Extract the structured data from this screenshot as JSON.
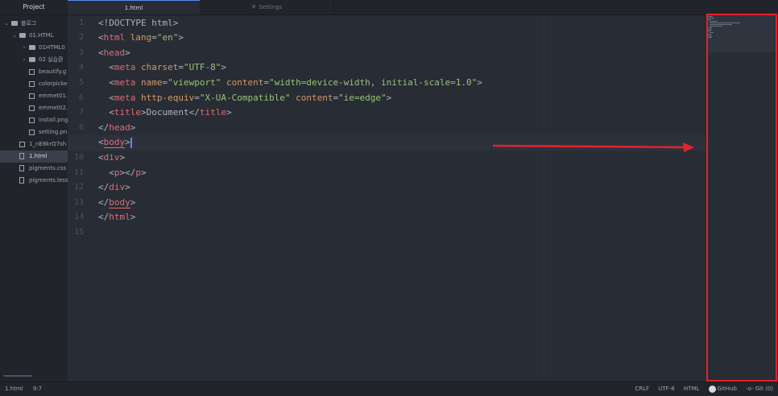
{
  "sidebar": {
    "tab_label": "Project",
    "items": [
      {
        "label": "블로그",
        "type": "folder",
        "expanded": true,
        "depth": 0
      },
      {
        "label": "01.HTML",
        "type": "folder",
        "expanded": true,
        "depth": 1
      },
      {
        "label": "01HTML0",
        "type": "folder",
        "expanded": false,
        "depth": 2
      },
      {
        "label": "02 실습환",
        "type": "folder",
        "expanded": false,
        "depth": 2
      },
      {
        "label": "beautify.g",
        "type": "image",
        "depth": 3
      },
      {
        "label": "colorpicke",
        "type": "image",
        "depth": 3
      },
      {
        "label": "emmet01.",
        "type": "image",
        "depth": 3
      },
      {
        "label": "emmet02.",
        "type": "image",
        "depth": 3
      },
      {
        "label": "install.png",
        "type": "image",
        "depth": 3
      },
      {
        "label": "setting.pn",
        "type": "image",
        "depth": 3
      },
      {
        "label": "1_nE8krQ7sh",
        "type": "image",
        "depth": 1
      },
      {
        "label": "1.html",
        "type": "file",
        "depth": 1,
        "selected": true
      },
      {
        "label": "pigments.css",
        "type": "file",
        "depth": 1
      },
      {
        "label": "pigments.less",
        "type": "file",
        "depth": 1
      }
    ]
  },
  "tabs": [
    {
      "label": "1.html",
      "active": true
    },
    {
      "label": "Settings",
      "active": false,
      "icon": "wrench-icon"
    }
  ],
  "editor": {
    "current_line": 9,
    "line_numbers": [
      "1",
      "2",
      "3",
      "4",
      "5",
      "6",
      "7",
      "8",
      "9",
      "10",
      "11",
      "12",
      "13",
      "14",
      "15"
    ],
    "lines": [
      [
        [
          "p",
          "<!DOCTYPE html>"
        ]
      ],
      [
        [
          "p",
          "<"
        ],
        [
          "t",
          "html"
        ],
        [
          "p",
          " "
        ],
        [
          "a",
          "lang"
        ],
        [
          "p",
          "="
        ],
        [
          "s",
          "\"en\""
        ],
        [
          "p",
          ">"
        ]
      ],
      [
        [
          "p",
          "<"
        ],
        [
          "t",
          "head"
        ],
        [
          "p",
          ">"
        ]
      ],
      [
        [
          "p",
          "  <"
        ],
        [
          "t",
          "meta"
        ],
        [
          "p",
          " "
        ],
        [
          "a",
          "charset"
        ],
        [
          "p",
          "="
        ],
        [
          "s",
          "\"UTF-8\""
        ],
        [
          "p",
          ">"
        ]
      ],
      [
        [
          "p",
          "  <"
        ],
        [
          "t",
          "meta"
        ],
        [
          "p",
          " "
        ],
        [
          "a",
          "name"
        ],
        [
          "p",
          "="
        ],
        [
          "s",
          "\"viewport\""
        ],
        [
          "p",
          " "
        ],
        [
          "a",
          "content"
        ],
        [
          "p",
          "="
        ],
        [
          "s",
          "\"width=device-width, initial-scale=1.0\""
        ],
        [
          "p",
          ">"
        ]
      ],
      [
        [
          "p",
          "  <"
        ],
        [
          "t",
          "meta"
        ],
        [
          "p",
          " "
        ],
        [
          "a",
          "http-equiv"
        ],
        [
          "p",
          "="
        ],
        [
          "s",
          "\"X-UA-Compatible\""
        ],
        [
          "p",
          " "
        ],
        [
          "a",
          "content"
        ],
        [
          "p",
          "="
        ],
        [
          "s",
          "\"ie=edge\""
        ],
        [
          "p",
          ">"
        ]
      ],
      [
        [
          "p",
          "  <"
        ],
        [
          "t",
          "title"
        ],
        [
          "p",
          ">Document</"
        ],
        [
          "t",
          "title"
        ],
        [
          "p",
          ">"
        ]
      ],
      [
        [
          "p",
          "</"
        ],
        [
          "t",
          "head"
        ],
        [
          "p",
          ">"
        ]
      ],
      [
        [
          "p",
          "<"
        ],
        [
          "tu",
          "body"
        ],
        [
          "p",
          ">"
        ]
      ],
      [
        [
          "p",
          "<"
        ],
        [
          "t",
          "div"
        ],
        [
          "p",
          ">"
        ]
      ],
      [
        [
          "p",
          "  <"
        ],
        [
          "t",
          "p"
        ],
        [
          "p",
          "></"
        ],
        [
          "t",
          "p"
        ],
        [
          "p",
          ">"
        ]
      ],
      [
        [
          "p",
          "</"
        ],
        [
          "t",
          "div"
        ],
        [
          "p",
          ">"
        ]
      ],
      [
        [
          "p",
          "</"
        ],
        [
          "tu",
          "body"
        ],
        [
          "p",
          ">"
        ]
      ],
      [
        [
          "p",
          "</"
        ],
        [
          "t",
          "html"
        ],
        [
          "p",
          ">"
        ]
      ],
      []
    ]
  },
  "statusbar": {
    "file": "1.html",
    "cursor_pos": "9:7",
    "line_ending": "CRLF",
    "encoding": "UTF-8",
    "grammar": "HTML",
    "github": "GitHub",
    "git": "Git (0)"
  },
  "colors": {
    "annotation": "#e8202a",
    "accent": "#568af2"
  }
}
